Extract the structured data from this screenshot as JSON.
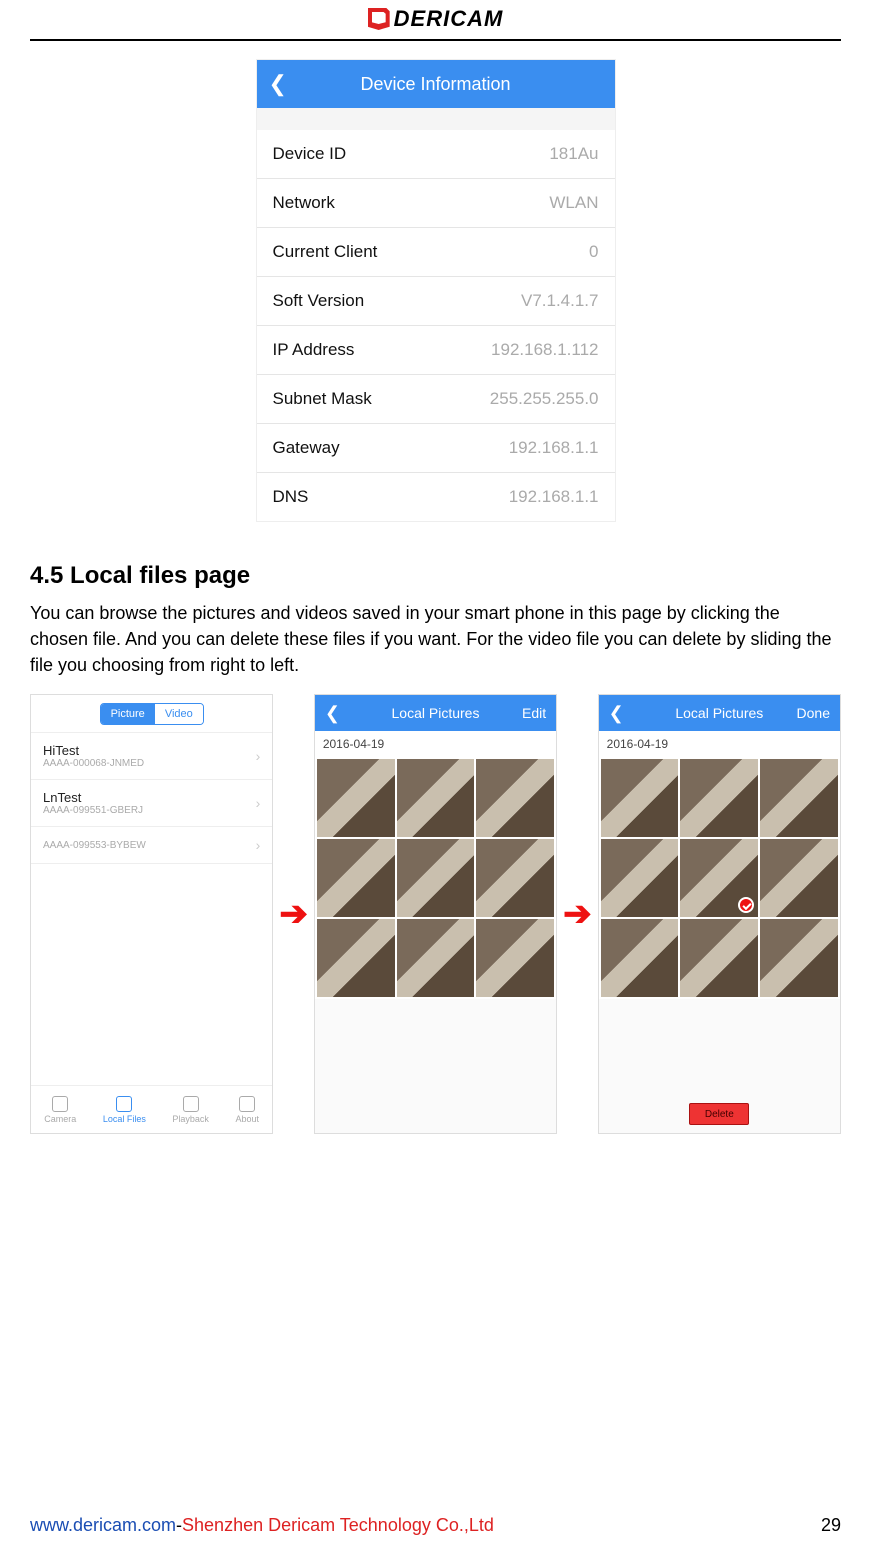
{
  "header": {
    "logo_text": "DERICAM"
  },
  "device_info": {
    "title": "Device Information",
    "rows": [
      {
        "label": "Device ID",
        "value": "181Au"
      },
      {
        "label": "Network",
        "value": "WLAN"
      },
      {
        "label": "Current Client",
        "value": "0"
      },
      {
        "label": "Soft Version",
        "value": "V7.1.4.1.7"
      },
      {
        "label": "IP Address",
        "value": "192.168.1.112"
      },
      {
        "label": "Subnet Mask",
        "value": "255.255.255.0"
      },
      {
        "label": "Gateway",
        "value": "192.168.1.1"
      },
      {
        "label": "DNS",
        "value": "192.168.1.1"
      }
    ]
  },
  "section": {
    "heading": "4.5 Local files page",
    "body": "You can browse the pictures and videos saved in your smart phone in this page by clicking the chosen file. And you can delete these files if you want. For the video file you can delete by sliding the file you choosing from right to left."
  },
  "phone1": {
    "segment": {
      "left": "Picture",
      "right": "Video"
    },
    "items": [
      {
        "title": "HiTest",
        "sub": "AAAA-000068-JNMED"
      },
      {
        "title": "LnTest",
        "sub": "AAAA-099551-GBERJ"
      },
      {
        "title": "",
        "sub": "AAAA-099553-BYBEW"
      }
    ],
    "tabs": {
      "camera": "Camera",
      "local": "Local Files",
      "playback": "Playback",
      "about": "About"
    }
  },
  "phone2": {
    "nav_title": "Local Pictures",
    "nav_right": "Edit",
    "date": "2016-04-19"
  },
  "phone3": {
    "nav_title": "Local Pictures",
    "nav_right": "Done",
    "date": "2016-04-19",
    "delete_label": "Delete"
  },
  "footer": {
    "url": "www.dericam.com",
    "dash": "-",
    "company": "Shenzhen Dericam Technology Co.,Ltd",
    "page": "29"
  }
}
